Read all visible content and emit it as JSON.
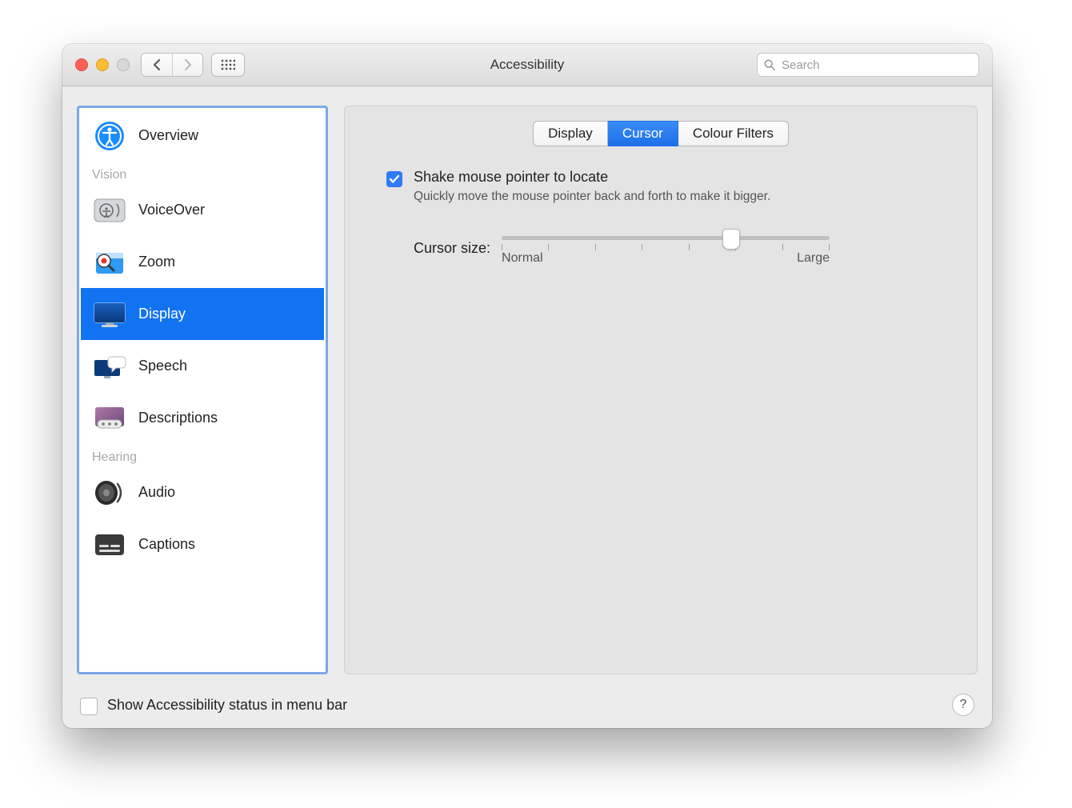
{
  "window": {
    "title": "Accessibility"
  },
  "toolbar": {
    "search_placeholder": "Search"
  },
  "sidebar": {
    "sections": [
      {
        "header": null,
        "items": [
          {
            "id": "overview",
            "label": "Overview",
            "selected": false
          }
        ]
      },
      {
        "header": "Vision",
        "items": [
          {
            "id": "voiceover",
            "label": "VoiceOver",
            "selected": false
          },
          {
            "id": "zoom",
            "label": "Zoom",
            "selected": false
          },
          {
            "id": "display",
            "label": "Display",
            "selected": true
          },
          {
            "id": "speech",
            "label": "Speech",
            "selected": false
          },
          {
            "id": "descriptions",
            "label": "Descriptions",
            "selected": false
          }
        ]
      },
      {
        "header": "Hearing",
        "items": [
          {
            "id": "audio",
            "label": "Audio",
            "selected": false
          },
          {
            "id": "captions",
            "label": "Captions",
            "selected": false
          }
        ]
      }
    ]
  },
  "tabs": [
    {
      "id": "display",
      "label": "Display",
      "active": false
    },
    {
      "id": "cursor",
      "label": "Cursor",
      "active": true
    },
    {
      "id": "colour-filters",
      "label": "Colour Filters",
      "active": false
    }
  ],
  "shake": {
    "checked": true,
    "label": "Shake mouse pointer to locate",
    "description": "Quickly move the mouse pointer back and forth to make it bigger."
  },
  "cursor_size": {
    "caption": "Cursor size:",
    "min_label": "Normal",
    "max_label": "Large",
    "value_percent": 70
  },
  "footer": {
    "show_status_checked": false,
    "show_status_label": "Show Accessibility status in menu bar"
  }
}
